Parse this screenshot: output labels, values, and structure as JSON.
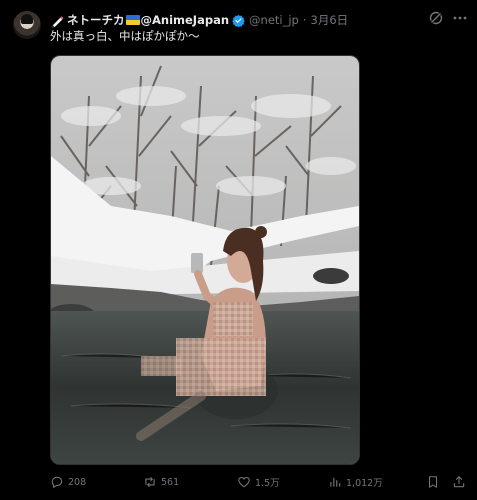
{
  "tweet": {
    "display_name": "ネトーチカ",
    "handle_name": "@AnimeJapan",
    "username": "@neti_jp",
    "separator": "·",
    "date": "3月6日",
    "text": "外は真っ白、中はぽかぽか〜",
    "icons": {
      "avatar": "avatar",
      "prefix": "pen-icon",
      "flag": "ukraine-flag-icon",
      "verified": "verified-badge-icon",
      "grok": "grok-icon",
      "more": "more-icon"
    },
    "verified_color": "#1d9bf0"
  },
  "actions": {
    "reply_count": "208",
    "retweet_count": "561",
    "like_count": "1.5万",
    "view_count": "1,012万"
  },
  "media": {
    "description_icon": "photo"
  },
  "colors": {
    "background": "#000000",
    "text": "#e7e9ea",
    "muted": "#71767b"
  }
}
